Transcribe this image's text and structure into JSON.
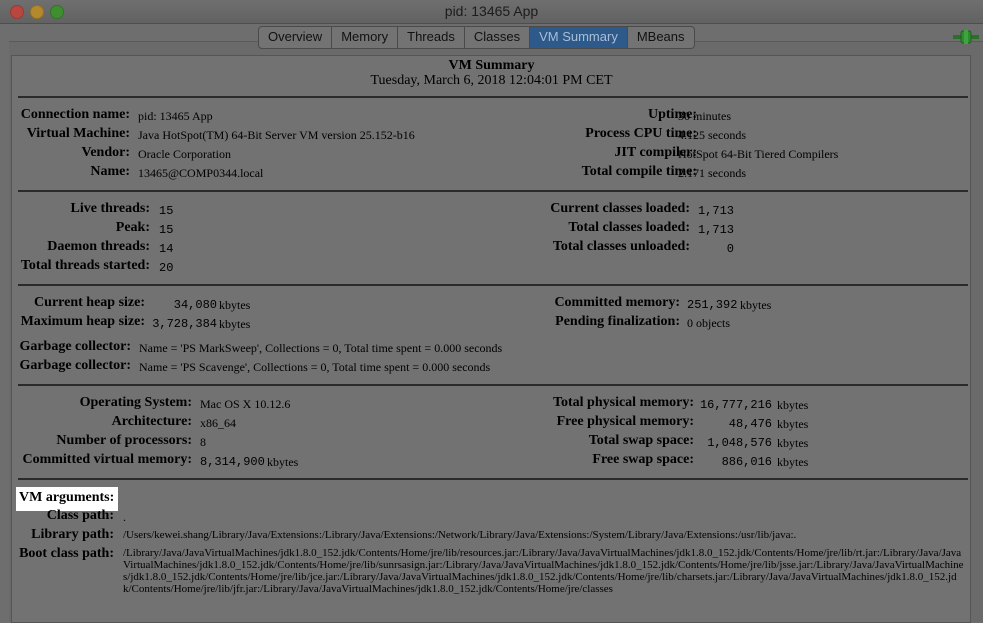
{
  "window": {
    "title": "pid: 13465 App",
    "tabs": [
      "Overview",
      "Memory",
      "Threads",
      "Classes",
      "VM Summary",
      "MBeans"
    ],
    "active_tab": "VM Summary"
  },
  "summary": {
    "title": "VM Summary",
    "date": "Tuesday, March 6, 2018 12:04:01 PM CET"
  },
  "connection": {
    "name_label": "Connection name:",
    "name": "pid: 13465 App",
    "vm_label": "Virtual Machine:",
    "vm": "Java HotSpot(TM) 64-Bit Server VM version 25.152-b16",
    "vendor_label": "Vendor:",
    "vendor": "Oracle Corporation",
    "host_label": "Name:",
    "host": "13465@COMP0344.local",
    "uptime_label": "Uptime:",
    "uptime": "30 minutes",
    "cpu_label": "Process CPU time:",
    "cpu": "4.125 seconds",
    "jit_label": "JIT compiler:",
    "jit": "HotSpot 64-Bit Tiered Compilers",
    "compile_label": "Total compile time:",
    "compile": "2.171 seconds"
  },
  "threads": {
    "live_label": "Live threads:",
    "live": "15",
    "peak_label": "Peak:",
    "peak": "15",
    "daemon_label": "Daemon threads:",
    "daemon": "14",
    "started_label": "Total threads started:",
    "started": "20",
    "cur_classes_label": "Current classes loaded:",
    "cur_classes": "1,713",
    "total_classes_label": "Total classes loaded:",
    "total_classes": "1,713",
    "unloaded_label": "Total classes unloaded:",
    "unloaded": "0"
  },
  "memory": {
    "heap_label": "Current heap size:",
    "heap": "34,080",
    "heap_unit": "kbytes",
    "maxheap_label": "Maximum heap size:",
    "maxheap": "3,728,384",
    "maxheap_unit": "kbytes",
    "committed_label": "Committed memory:",
    "committed": "251,392",
    "committed_unit": "kbytes",
    "pending_label": "Pending finalization:",
    "pending": "0 objects",
    "gc1_label": "Garbage collector:",
    "gc1": "Name = 'PS MarkSweep', Collections = 0, Total time spent = 0.000 seconds",
    "gc2_label": "Garbage collector:",
    "gc2": "Name = 'PS Scavenge', Collections = 0, Total time spent = 0.000 seconds"
  },
  "os": {
    "os_label": "Operating System:",
    "os": "Mac OS X 10.12.6",
    "arch_label": "Architecture:",
    "arch": "x86_64",
    "procs_label": "Number of processors:",
    "procs": "8",
    "cvm_label": "Committed virtual memory:",
    "cvm": "8,314,900",
    "cvm_unit": "kbytes",
    "tpm_label": "Total physical memory:",
    "tpm": "16,777,216",
    "tpm_unit": "kbytes",
    "fpm_label": "Free physical memory:",
    "fpm": "48,476",
    "fpm_unit": "kbytes",
    "tss_label": "Total swap space:",
    "tss": "1,048,576",
    "tss_unit": "kbytes",
    "fss_label": "Free swap space:",
    "fss": "886,016",
    "fss_unit": "kbytes"
  },
  "vm_args": {
    "heading": "VM arguments:",
    "classpath_label": "Class path:",
    "classpath": ".",
    "libpath_label": "Library path:",
    "libpath": "/Users/kewei.shang/Library/Java/Extensions:/Library/Java/Extensions:/Network/Library/Java/Extensions:/System/Library/Java/Extensions:/usr/lib/java:.",
    "bootpath_label": "Boot class path:",
    "bootpath": "/Library/Java/JavaVirtualMachines/jdk1.8.0_152.jdk/Contents/Home/jre/lib/resources.jar:/Library/Java/JavaVirtualMachines/jdk1.8.0_152.jdk/Contents/Home/jre/lib/rt.jar:/Library/Java/JavaVirtualMachines/jdk1.8.0_152.jdk/Contents/Home/jre/lib/sunrsasign.jar:/Library/Java/JavaVirtualMachines/jdk1.8.0_152.jdk/Contents/Home/jre/lib/jsse.jar:/Library/Java/JavaVirtualMachines/jdk1.8.0_152.jdk/Contents/Home/jre/lib/jce.jar:/Library/Java/JavaVirtualMachines/jdk1.8.0_152.jdk/Contents/Home/jre/lib/charsets.jar:/Library/Java/JavaVirtualMachines/jdk1.8.0_152.jdk/Contents/Home/jre/lib/jfr.jar:/Library/Java/JavaVirtualMachines/jdk1.8.0_152.jdk/Contents/Home/jre/classes"
  },
  "icons": {
    "connection": "plug-connector-icon"
  },
  "colors": {
    "active_tab": "#2d5a8a",
    "connector": "#2e8b2e"
  }
}
